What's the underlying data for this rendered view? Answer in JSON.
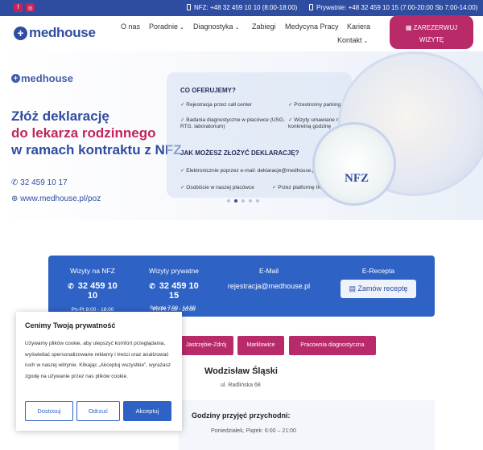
{
  "topbar": {
    "phone_nfz": "NFZ: +48 32 459 10 10 (8:00-18:00)",
    "phone_private": "Prywatnie: +48 32 459 10 15 (7:00-20:00 Sb 7:00-14:00)"
  },
  "nav": {
    "logo": "medhouse",
    "items": [
      "O nas",
      "Poradnie",
      "Diagnostyka",
      "Zabiegi",
      "Medycyna Pracy",
      "Kariera",
      "Kontakt"
    ],
    "reserve_line1": "ZAREZERWUJ",
    "reserve_line2": "WIZYTĘ"
  },
  "hero": {
    "logo": "medhouse",
    "title_line1": "Złóż deklarację",
    "title_line2": "do lekarza rodzinnego",
    "title_line3": "w ramach kontraktu z NFZ",
    "phone": "32 459 10 17",
    "url": "www.medhouse.pl/poz",
    "panel_heading1": "CO OFERUJEMY?",
    "offer_left": [
      "Rejestracja przez call center",
      "Badania diagnostyczne w placówce (USG, RTG, laboratorium)"
    ],
    "offer_right": [
      "Przestronny parking",
      "Wizyty umawiane na konkretną godzinę"
    ],
    "panel_heading2": "JAK MOŻESZ ZŁOŻYĆ DEKLARACJĘ?",
    "method1": "Elektronicznie poprzez e-mail: deklaracje@medhouse.pl",
    "method2": "Osobiście w naszej placówce",
    "method3": "Przez platformę IKP",
    "nfz": "NFZ"
  },
  "contact": {
    "nfz_heading": "Wizyty na NFZ",
    "nfz_phone": "32 459 10 10",
    "nfz_hours": "Pn-Pt 8:00 - 18:00",
    "private_heading": "Wizyty prywatne",
    "private_phone": "32 459 10 15",
    "private_hours": "Pn-Pt 7:00 - 20:00",
    "private_saturday": "Sobota 7:00 - 14:00",
    "email_heading": "E-Mail",
    "email": "rejestracja@medhouse.pl",
    "erecepta_heading": "E-Recepta",
    "erecepta_button": "Zamów receptę"
  },
  "locations": {
    "buttons": [
      "Jastrzębie-Zdrój",
      "Marklowice",
      "Pracownia diagnostyczna"
    ],
    "city": "Wodzisław Śląski",
    "street": "ul. Radlińska 68",
    "hours_heading": "Godziny przyjęć przychodni:",
    "hours_row": "Poniedziałek, Piątek: 6:00 – 21:00"
  },
  "cookie": {
    "title": "Cenimy Twoją prywatność",
    "text": "Używamy plików cookie, aby ulepszyć komfort przeglądania, wyświetlać spersonalizowane reklamy i treści oraz analizować ruch w naszej witrynie. Klikając „Akceptuj wszystkie”, wyrażasz zgodę na używanie przez nas plików cookie.",
    "btn_customize": "Dostosuj",
    "btn_reject": "Odrzuć",
    "btn_accept": "Akceptuj"
  },
  "colors": {
    "brand_blue": "#2f4da0",
    "strip_blue": "#2f62c5",
    "brand_pink": "#b92a6a"
  }
}
